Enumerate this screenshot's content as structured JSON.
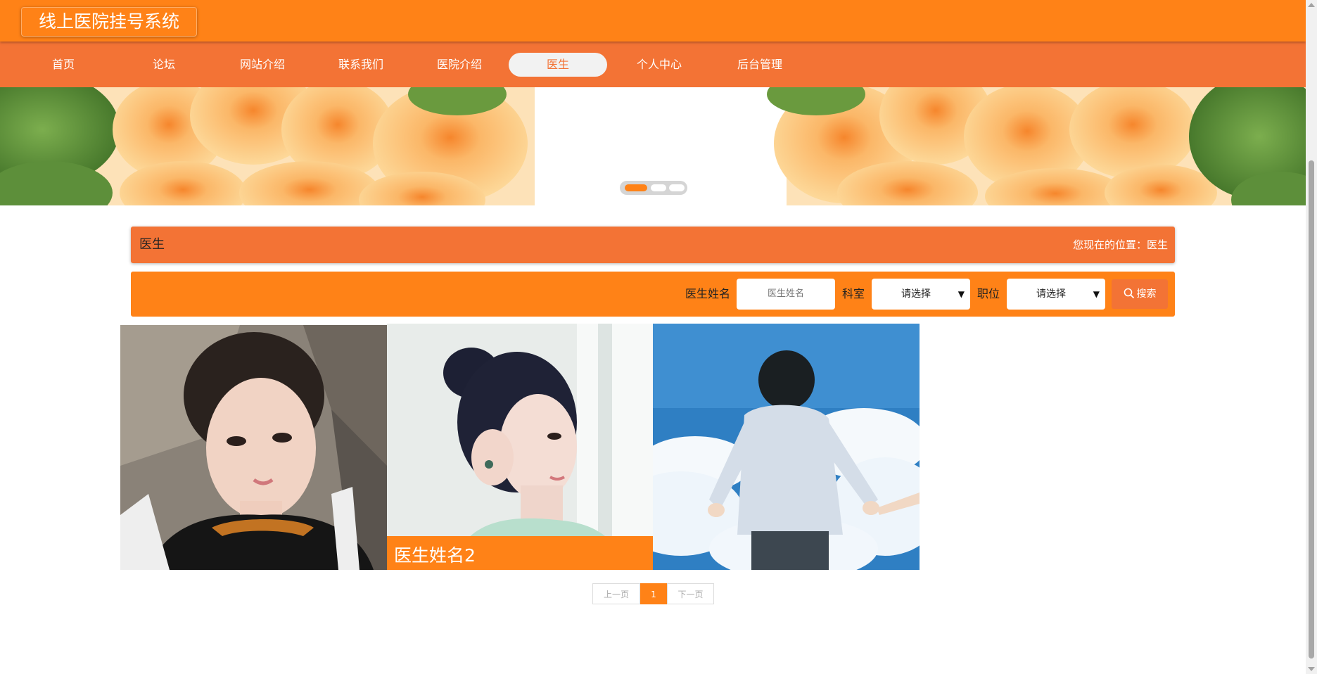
{
  "header": {
    "title": "线上医院挂号系统"
  },
  "nav": {
    "items": [
      {
        "label": "首页",
        "active": false
      },
      {
        "label": "论坛",
        "active": false
      },
      {
        "label": "网站介绍",
        "active": false
      },
      {
        "label": "联系我们",
        "active": false
      },
      {
        "label": "医院介绍",
        "active": false
      },
      {
        "label": "医生",
        "active": true
      },
      {
        "label": "个人中心",
        "active": false
      },
      {
        "label": "后台管理",
        "active": false
      }
    ]
  },
  "banner": {
    "slides": 3,
    "active_slide": 1
  },
  "breadcrumb": {
    "title": "医生",
    "location": "您现在的位置：医生"
  },
  "search": {
    "name_label": "医生姓名",
    "name_placeholder": "医生姓名",
    "dept_label": "科室",
    "dept_selected": "请选择",
    "position_label": "职位",
    "position_selected": "请选择",
    "button_label": "搜索",
    "button_icon": "search-icon"
  },
  "doctors": [
    {
      "caption": ""
    },
    {
      "caption": "医生姓名2"
    },
    {
      "caption": ""
    }
  ],
  "pagination": {
    "prev": "上一页",
    "current": "1",
    "next": "下一页"
  },
  "colors": {
    "primary": "#ff8217",
    "nav": "#f37335"
  }
}
